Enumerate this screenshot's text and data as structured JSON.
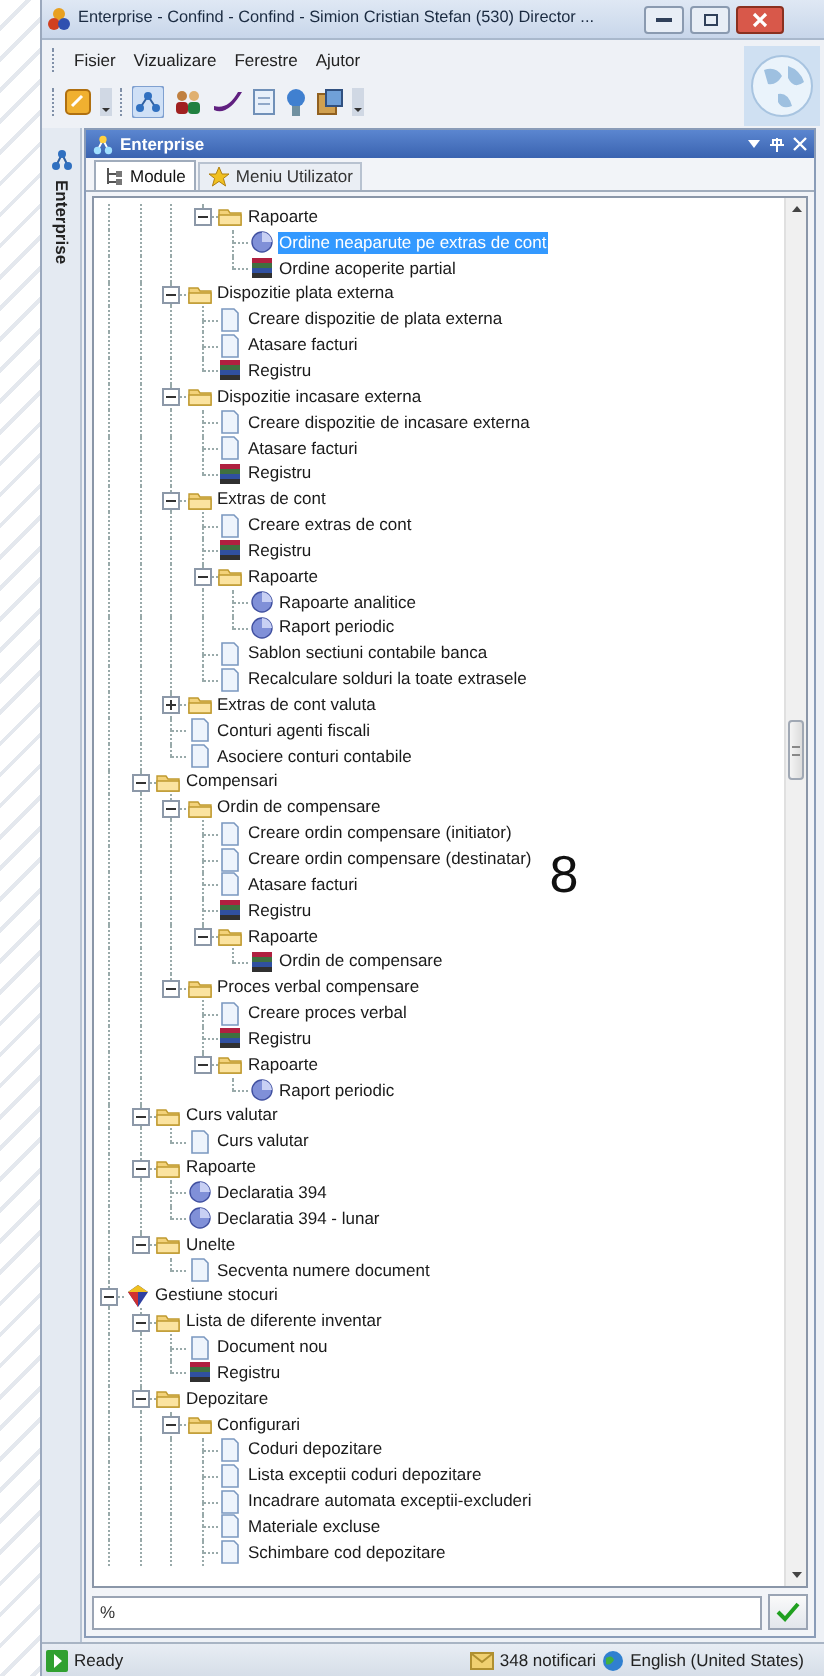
{
  "window": {
    "title": "Enterprise - Confind - Confind - Simion Cristian Stefan (530) Director ..."
  },
  "menu": [
    "Fisier",
    "Vizualizare",
    "Ferestre",
    "Ajutor"
  ],
  "side_tab": {
    "label": "Enterprise"
  },
  "panel": {
    "title": "Enterprise",
    "tabs": [
      {
        "label": "Module",
        "selected": true
      },
      {
        "label": "Meniu Utilizator",
        "selected": false
      }
    ],
    "tree": [
      {
        "children": [
          {
            "children": [
              {
                "children": [
                  {
                    "label": "Rapoarte",
                    "kind": "folder",
                    "selected": false,
                    "expanded": true,
                    "children": [
                      {
                        "label": "Ordine neaparute pe extras de cont",
                        "kind": "report",
                        "selected": true
                      },
                      {
                        "label": "Ordine acoperite partial",
                        "kind": "register",
                        "selected": false
                      }
                    ]
                  }
                ]
              },
              {
                "label": "Dispozitie plata externa",
                "kind": "folder",
                "selected": false,
                "expanded": true,
                "children": [
                  {
                    "label": "Creare dispozitie de plata externa",
                    "kind": "document",
                    "selected": false
                  },
                  {
                    "label": "Atasare facturi",
                    "kind": "document",
                    "selected": false
                  },
                  {
                    "label": "Registru",
                    "kind": "register",
                    "selected": false
                  }
                ]
              },
              {
                "label": "Dispozitie incasare externa",
                "kind": "folder",
                "selected": false,
                "expanded": true,
                "children": [
                  {
                    "label": "Creare dispozitie de incasare externa",
                    "kind": "document",
                    "selected": false
                  },
                  {
                    "label": "Atasare facturi",
                    "kind": "document",
                    "selected": false
                  },
                  {
                    "label": "Registru",
                    "kind": "register",
                    "selected": false
                  }
                ]
              },
              {
                "label": "Extras de cont",
                "kind": "folder",
                "selected": false,
                "expanded": true,
                "children": [
                  {
                    "label": "Creare extras de cont",
                    "kind": "document",
                    "selected": false
                  },
                  {
                    "label": "Registru",
                    "kind": "register",
                    "selected": false
                  },
                  {
                    "label": "Rapoarte",
                    "kind": "folder",
                    "selected": false,
                    "expanded": true,
                    "children": [
                      {
                        "label": "Rapoarte analitice",
                        "kind": "report",
                        "selected": false
                      },
                      {
                        "label": "Raport periodic",
                        "kind": "report",
                        "selected": false
                      }
                    ]
                  },
                  {
                    "label": "Sablon sectiuni contabile banca",
                    "kind": "document",
                    "selected": false
                  },
                  {
                    "label": "Recalculare solduri la toate extrasele",
                    "kind": "document",
                    "selected": false
                  }
                ]
              },
              {
                "label": "Extras de cont valuta",
                "kind": "folder",
                "selected": false,
                "expanded": false
              },
              {
                "label": "Conturi agenti fiscali",
                "kind": "document",
                "selected": false
              },
              {
                "label": "Asociere conturi contabile",
                "kind": "document",
                "selected": false
              }
            ]
          },
          {
            "label": "Compensari",
            "kind": "folder",
            "selected": false,
            "expanded": true,
            "children": [
              {
                "label": "Ordin de compensare",
                "kind": "folder",
                "selected": false,
                "expanded": true,
                "children": [
                  {
                    "label": "Creare ordin compensare (initiator)",
                    "kind": "document",
                    "selected": false
                  },
                  {
                    "label": "Creare ordin compensare (destinatar)",
                    "kind": "document",
                    "selected": false
                  },
                  {
                    "label": "Atasare facturi",
                    "kind": "document",
                    "selected": false
                  },
                  {
                    "label": "Registru",
                    "kind": "register",
                    "selected": false
                  },
                  {
                    "label": "Rapoarte",
                    "kind": "folder",
                    "selected": false,
                    "expanded": true,
                    "children": [
                      {
                        "label": "Ordin de compensare",
                        "kind": "register",
                        "selected": false
                      }
                    ]
                  }
                ]
              },
              {
                "label": "Proces verbal compensare",
                "kind": "folder",
                "selected": false,
                "expanded": true,
                "children": [
                  {
                    "label": "Creare proces verbal",
                    "kind": "document",
                    "selected": false
                  },
                  {
                    "label": "Registru",
                    "kind": "register",
                    "selected": false
                  },
                  {
                    "label": "Rapoarte",
                    "kind": "folder",
                    "selected": false,
                    "expanded": true,
                    "children": [
                      {
                        "label": "Raport periodic",
                        "kind": "report",
                        "selected": false
                      }
                    ]
                  }
                ]
              }
            ]
          },
          {
            "label": "Curs valutar",
            "kind": "folder",
            "selected": false,
            "expanded": true,
            "children": [
              {
                "label": "Curs valutar",
                "kind": "document",
                "selected": false
              }
            ]
          },
          {
            "label": "Rapoarte",
            "kind": "folder",
            "selected": false,
            "expanded": true,
            "children": [
              {
                "label": "Declaratia 394",
                "kind": "report",
                "selected": false
              },
              {
                "label": "Declaratia 394 - lunar",
                "kind": "report",
                "selected": false
              }
            ]
          },
          {
            "label": "Unelte",
            "kind": "folder",
            "selected": false,
            "expanded": true,
            "children": [
              {
                "label": "Secventa numere document",
                "kind": "document",
                "selected": false
              }
            ]
          }
        ]
      },
      {
        "label": "Gestiune stocuri",
        "kind": "module",
        "selected": false,
        "expanded": true,
        "children": [
          {
            "label": "Lista de diferente inventar",
            "kind": "folder",
            "selected": false,
            "expanded": true,
            "children": [
              {
                "label": "Document nou",
                "kind": "document",
                "selected": false
              },
              {
                "label": "Registru",
                "kind": "register",
                "selected": false
              }
            ]
          },
          {
            "label": "Depozitare",
            "kind": "folder",
            "selected": false,
            "expanded": true,
            "children": [
              {
                "label": "Configurari",
                "kind": "folder",
                "selected": false,
                "expanded": true,
                "children": [
                  {
                    "label": "Coduri depozitare",
                    "kind": "document",
                    "selected": false
                  },
                  {
                    "label": "Lista exceptii coduri depozitare",
                    "kind": "document",
                    "selected": false
                  },
                  {
                    "label": "Incadrare automata exceptii-excluderi",
                    "kind": "document",
                    "selected": false
                  },
                  {
                    "label": "Materiale excluse",
                    "kind": "document",
                    "selected": false
                  },
                  {
                    "label": "Schimbare cod depozitare",
                    "kind": "document",
                    "selected": false
                  }
                ]
              }
            ]
          }
        ]
      }
    ],
    "annotation": "8",
    "filter": {
      "value": "%"
    }
  },
  "status_bar": {
    "status": "Ready",
    "notifications": "348 notificari",
    "language": "English (United States)"
  }
}
